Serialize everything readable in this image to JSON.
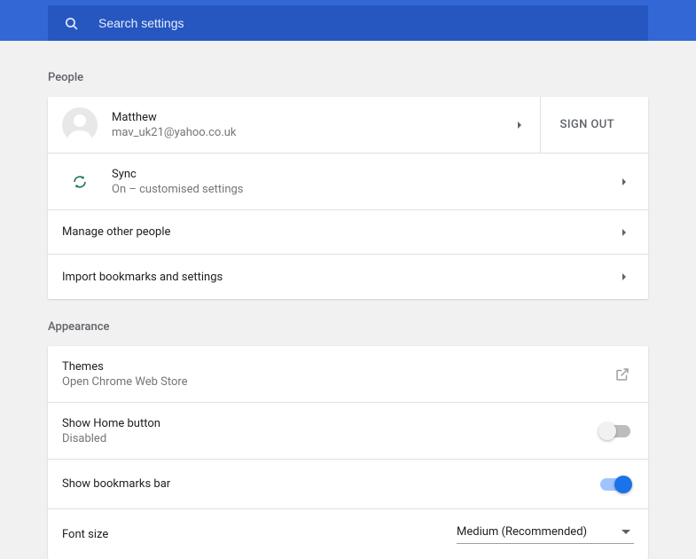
{
  "search": {
    "placeholder": "Search settings"
  },
  "sections": {
    "people": {
      "title": "People",
      "account": {
        "name": "Matthew",
        "email": "mav_uk21@yahoo.co.uk",
        "sign_out_label": "SIGN OUT"
      },
      "sync": {
        "title": "Sync",
        "status": "On – customised settings"
      },
      "manage_others": "Manage other people",
      "import_bookmarks": "Import bookmarks and settings"
    },
    "appearance": {
      "title": "Appearance",
      "themes": {
        "title": "Themes",
        "subtitle": "Open Chrome Web Store"
      },
      "home_button": {
        "title": "Show Home button",
        "status": "Disabled",
        "enabled": false
      },
      "bookmarks_bar": {
        "title": "Show bookmarks bar",
        "enabled": true
      },
      "font_size": {
        "title": "Font size",
        "selected": "Medium (Recommended)"
      }
    }
  }
}
